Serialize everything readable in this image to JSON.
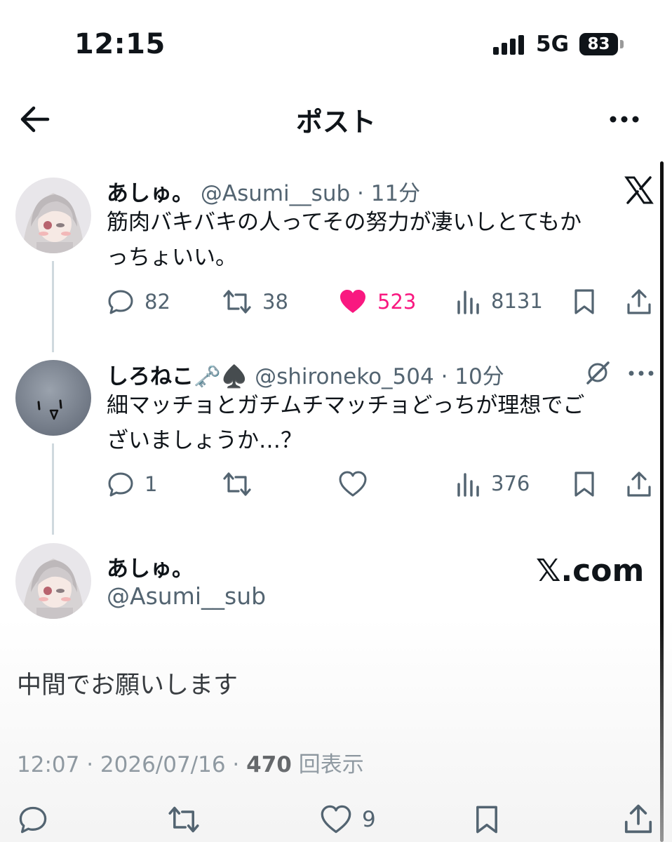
{
  "status_bar": {
    "time": "12:15",
    "network": "5G",
    "battery": "83"
  },
  "header": {
    "title": "ポスト",
    "back_icon": "arrow-left-icon",
    "more_icon": "more-horizontal-icon"
  },
  "quoted_thread": [
    {
      "name": "あしゅ。",
      "handle": "@Asumi__sub",
      "time": "· 11分",
      "text_line1": "筋肉バキバキの人ってその努力が凄いしとてもか",
      "text_line2": "っちょいい。",
      "reply_count": "82",
      "repost_count": "38",
      "like_count": "523",
      "view_count": "8131",
      "liked": true,
      "like_color": "#f91880"
    },
    {
      "name": "しろねこ🗝️♠️",
      "handle": "@shironeko_504",
      "time": "· 10分",
      "text_line1": "細マッチョとガチムチマッチョどっちが理想でご",
      "text_line2": "ざいましょうか…？",
      "reply_count": "1",
      "view_count": "376"
    }
  ],
  "main_post": {
    "name": "あしゅ。",
    "handle": "@Asumi__sub",
    "brand": "𝕏.com",
    "text": "中間でお願いします",
    "time": "12:07 · 2026/07/16 · ",
    "views_count": "470",
    "views_label": " 回表示",
    "like_count": "9"
  },
  "colors": {
    "secondary_text": "#536471",
    "primary_text": "#0f1419",
    "thread_line": "#cfd9de"
  }
}
